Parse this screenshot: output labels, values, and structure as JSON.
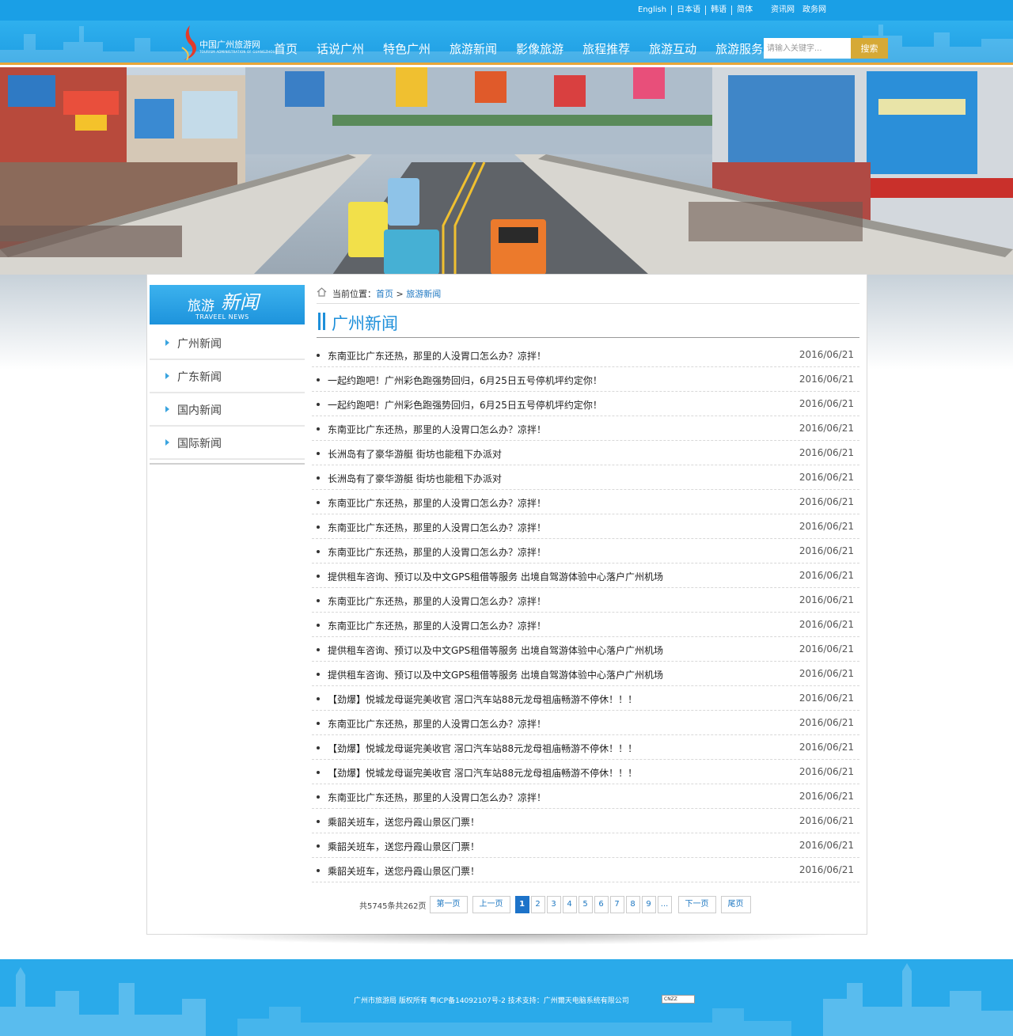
{
  "topbar": {
    "languages": [
      "English",
      "日本语",
      "韩语",
      "简体"
    ],
    "sites": [
      "资讯网",
      "政务网"
    ]
  },
  "logo": {
    "name": "中国广州旅游网",
    "subtitle": "TOURISM ADMINISTRATION OF GUANGZHOU"
  },
  "nav": [
    "首页",
    "话说广州",
    "特色广州",
    "旅游新闻",
    "影像旅游",
    "旅程推荐",
    "旅游互动",
    "旅游服务"
  ],
  "search": {
    "placeholder": "请输入关键字...",
    "button": "搜索"
  },
  "sidebar": {
    "title_cn_a": "旅游",
    "title_cn_b": "新闻",
    "title_en": "TRAVEEL NEWS",
    "items": [
      "广州新闻",
      "广东新闻",
      "国内新闻",
      "国际新闻"
    ]
  },
  "breadcrumb": {
    "label": "当前位置：",
    "home": "首页",
    "sep": " > ",
    "current": "旅游新闻"
  },
  "section_title": "广州新闻",
  "news": [
    {
      "title": "东南亚比广东还热，那里的人没胃口怎么办？凉拌！",
      "date": "2016/06/21"
    },
    {
      "title": "一起约跑吧！广州彩色跑强势回归，6月25日五号停机坪约定你！",
      "date": "2016/06/21"
    },
    {
      "title": "一起约跑吧！广州彩色跑强势回归，6月25日五号停机坪约定你！",
      "date": "2016/06/21"
    },
    {
      "title": "东南亚比广东还热，那里的人没胃口怎么办？凉拌！",
      "date": "2016/06/21"
    },
    {
      "title": "长洲岛有了豪华游艇 街坊也能租下办派对",
      "date": "2016/06/21"
    },
    {
      "title": "长洲岛有了豪华游艇 街坊也能租下办派对",
      "date": "2016/06/21"
    },
    {
      "title": "东南亚比广东还热，那里的人没胃口怎么办？凉拌！",
      "date": "2016/06/21"
    },
    {
      "title": "东南亚比广东还热，那里的人没胃口怎么办？凉拌！",
      "date": "2016/06/21"
    },
    {
      "title": "东南亚比广东还热，那里的人没胃口怎么办？凉拌！",
      "date": "2016/06/21"
    },
    {
      "title": "提供租车咨询、预订以及中文GPS租借等服务 出境自驾游体验中心落户广州机场",
      "date": "2016/06/21"
    },
    {
      "title": "东南亚比广东还热，那里的人没胃口怎么办？凉拌！",
      "date": "2016/06/21"
    },
    {
      "title": "东南亚比广东还热，那里的人没胃口怎么办？凉拌！",
      "date": "2016/06/21"
    },
    {
      "title": "提供租车咨询、预订以及中文GPS租借等服务 出境自驾游体验中心落户广州机场",
      "date": "2016/06/21"
    },
    {
      "title": "提供租车咨询、预订以及中文GPS租借等服务 出境自驾游体验中心落户广州机场",
      "date": "2016/06/21"
    },
    {
      "title": "【劲爆】悦城龙母诞完美收官 滘口汽车站88元龙母祖庙畅游不停休！！！",
      "date": "2016/06/21"
    },
    {
      "title": "东南亚比广东还热，那里的人没胃口怎么办？凉拌！",
      "date": "2016/06/21"
    },
    {
      "title": "【劲爆】悦城龙母诞完美收官 滘口汽车站88元龙母祖庙畅游不停休！！！",
      "date": "2016/06/21"
    },
    {
      "title": "【劲爆】悦城龙母诞完美收官 滘口汽车站88元龙母祖庙畅游不停休！！！",
      "date": "2016/06/21"
    },
    {
      "title": "东南亚比广东还热，那里的人没胃口怎么办？凉拌！",
      "date": "2016/06/21"
    },
    {
      "title": "乘韶关班车，送您丹霞山景区门票！",
      "date": "2016/06/21"
    },
    {
      "title": "乘韶关班车，送您丹霞山景区门票！",
      "date": "2016/06/21"
    },
    {
      "title": "乘韶关班车，送您丹霞山景区门票！",
      "date": "2016/06/21"
    }
  ],
  "pager": {
    "total": "共5745条共262页",
    "first": "第一页",
    "prev": "上一页",
    "pages": [
      "1",
      "2",
      "3",
      "4",
      "5",
      "6",
      "7",
      "8",
      "9",
      "..."
    ],
    "current": "1",
    "next": "下一页",
    "last": "尾页"
  },
  "footer": {
    "copyright": "广州市旅游局  版权所有    粤ICP备14092107号-2    技术支持：广州爾天电脑系统有限公司",
    "badge": "CNZZ"
  },
  "colors": {
    "primary_blue": "#1a9fe6",
    "accent_gold": "#d6a936",
    "link_blue": "#1f78c2",
    "active_page": "#1d73c9"
  }
}
